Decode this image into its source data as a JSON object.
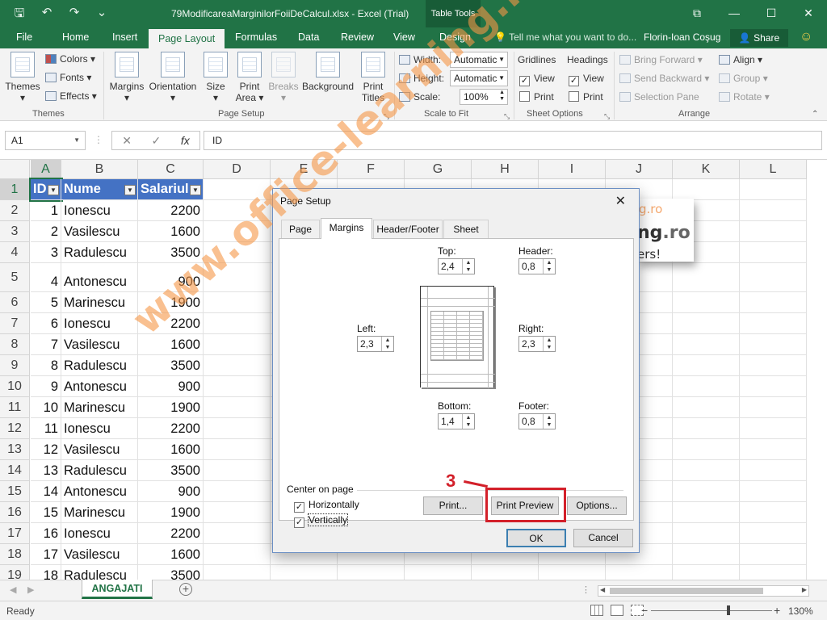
{
  "titlebar": {
    "doc_title": "79ModificareaMarginilorFoiiDeCalcul.xlsx - Excel (Trial)",
    "context_tab_group": "Table Tools",
    "minimize": "—",
    "restore": "☐",
    "close": "✕"
  },
  "tabs": {
    "file": "File",
    "home": "Home",
    "insert": "Insert",
    "page_layout": "Page Layout",
    "formulas": "Formulas",
    "data": "Data",
    "review": "Review",
    "view": "View",
    "design": "Design",
    "tellme": "Tell me what you want to do...",
    "user": "Florin-Ioan Coşug",
    "share": "Share"
  },
  "ribbon": {
    "themes": {
      "themes": "Themes",
      "colors": "Colors",
      "fonts": "Fonts",
      "effects": "Effects",
      "group": "Themes"
    },
    "page_setup": {
      "margins": "Margins",
      "orientation": "Orientation",
      "size": "Size",
      "print_area_1": "Print",
      "print_area_2": "Area",
      "breaks": "Breaks",
      "background": "Background",
      "print_titles_1": "Print",
      "print_titles_2": "Titles",
      "group": "Page Setup"
    },
    "scale": {
      "width_label": "Width:",
      "width_value": "Automatic",
      "height_label": "Height:",
      "height_value": "Automatic",
      "scale_label": "Scale:",
      "scale_value": "100%",
      "group": "Scale to Fit"
    },
    "sheet_options": {
      "gridlines": "Gridlines",
      "headings": "Headings",
      "view": "View",
      "print": "Print",
      "group": "Sheet Options"
    },
    "arrange": {
      "bring_forward": "Bring Forward",
      "send_backward": "Send Backward",
      "selection_pane": "Selection Pane",
      "align": "Align",
      "group_btn": "Group",
      "rotate": "Rotate",
      "group": "Arrange"
    }
  },
  "formula_bar": {
    "name_box": "A1",
    "cancel": "✕",
    "enter": "✓",
    "fx": "fx",
    "content": "ID"
  },
  "sheet": {
    "columns": [
      "A",
      "B",
      "C",
      "D",
      "E",
      "F",
      "G",
      "H",
      "I",
      "J",
      "K",
      "L"
    ],
    "header_row": [
      "ID",
      "Nume",
      "Salariul"
    ],
    "row_numbers": [
      "1",
      "2",
      "3",
      "4",
      "5",
      "6",
      "7",
      "8",
      "9",
      "10",
      "11",
      "12",
      "13",
      "14",
      "15",
      "16",
      "17",
      "18",
      "19"
    ],
    "rows": [
      [
        "1",
        "Ionescu",
        "2200"
      ],
      [
        "2",
        "Vasilescu",
        "1600"
      ],
      [
        "3",
        "Radulescu",
        "3500"
      ],
      [
        "4",
        "Antonescu",
        "900"
      ],
      [
        "5",
        "Marinescu",
        "1900"
      ],
      [
        "6",
        "Ionescu",
        "2200"
      ],
      [
        "7",
        "Vasilescu",
        "1600"
      ],
      [
        "8",
        "Radulescu",
        "3500"
      ],
      [
        "9",
        "Antonescu",
        "900"
      ],
      [
        "10",
        "Marinescu",
        "1900"
      ],
      [
        "11",
        "Ionescu",
        "2200"
      ],
      [
        "12",
        "Vasilescu",
        "1600"
      ],
      [
        "13",
        "Radulescu",
        "3500"
      ],
      [
        "14",
        "Antonescu",
        "900"
      ],
      [
        "15",
        "Marinescu",
        "1900"
      ],
      [
        "16",
        "Ionescu",
        "2200"
      ],
      [
        "17",
        "Vasilescu",
        "1600"
      ],
      [
        "18",
        "Radulescu",
        "3500"
      ]
    ]
  },
  "bg_note": {
    "line1": "g.ro",
    "line2a": "ng",
    "line2b": ".ro",
    "line3": "ers!"
  },
  "dialog": {
    "title": "Page Setup",
    "close": "✕",
    "tabs": [
      "Page",
      "Margins",
      "Header/Footer",
      "Sheet"
    ],
    "active_tab": "Margins",
    "top_label": "Top:",
    "top_value": "2,4",
    "header_label": "Header:",
    "header_value": "0,8",
    "left_label": "Left:",
    "left_value": "2,3",
    "right_label": "Right:",
    "right_value": "2,3",
    "bottom_label": "Bottom:",
    "bottom_value": "1,4",
    "footer_label": "Footer:",
    "footer_value": "0,8",
    "center_on_page": "Center on page",
    "horizontally": "Horizontally",
    "vertically": "Vertically",
    "horizontally_checked": true,
    "vertically_checked": true,
    "print_btn": "Print...",
    "print_preview_btn": "Print Preview",
    "options_btn": "Options...",
    "ok_btn": "OK",
    "cancel_btn": "Cancel"
  },
  "annotation": {
    "step": "3"
  },
  "watermark": "www.office-learning.ro",
  "sheet_tabs": {
    "active": "ANGAJATI",
    "add": "+"
  },
  "status": {
    "ready": "Ready",
    "zoom": "130%",
    "zoom_minus": "−",
    "zoom_plus": "+"
  },
  "colors": {
    "excel_green": "#217346",
    "table_header": "#4472c4",
    "annotation_red": "#d3202a",
    "watermark": "#f59646"
  }
}
